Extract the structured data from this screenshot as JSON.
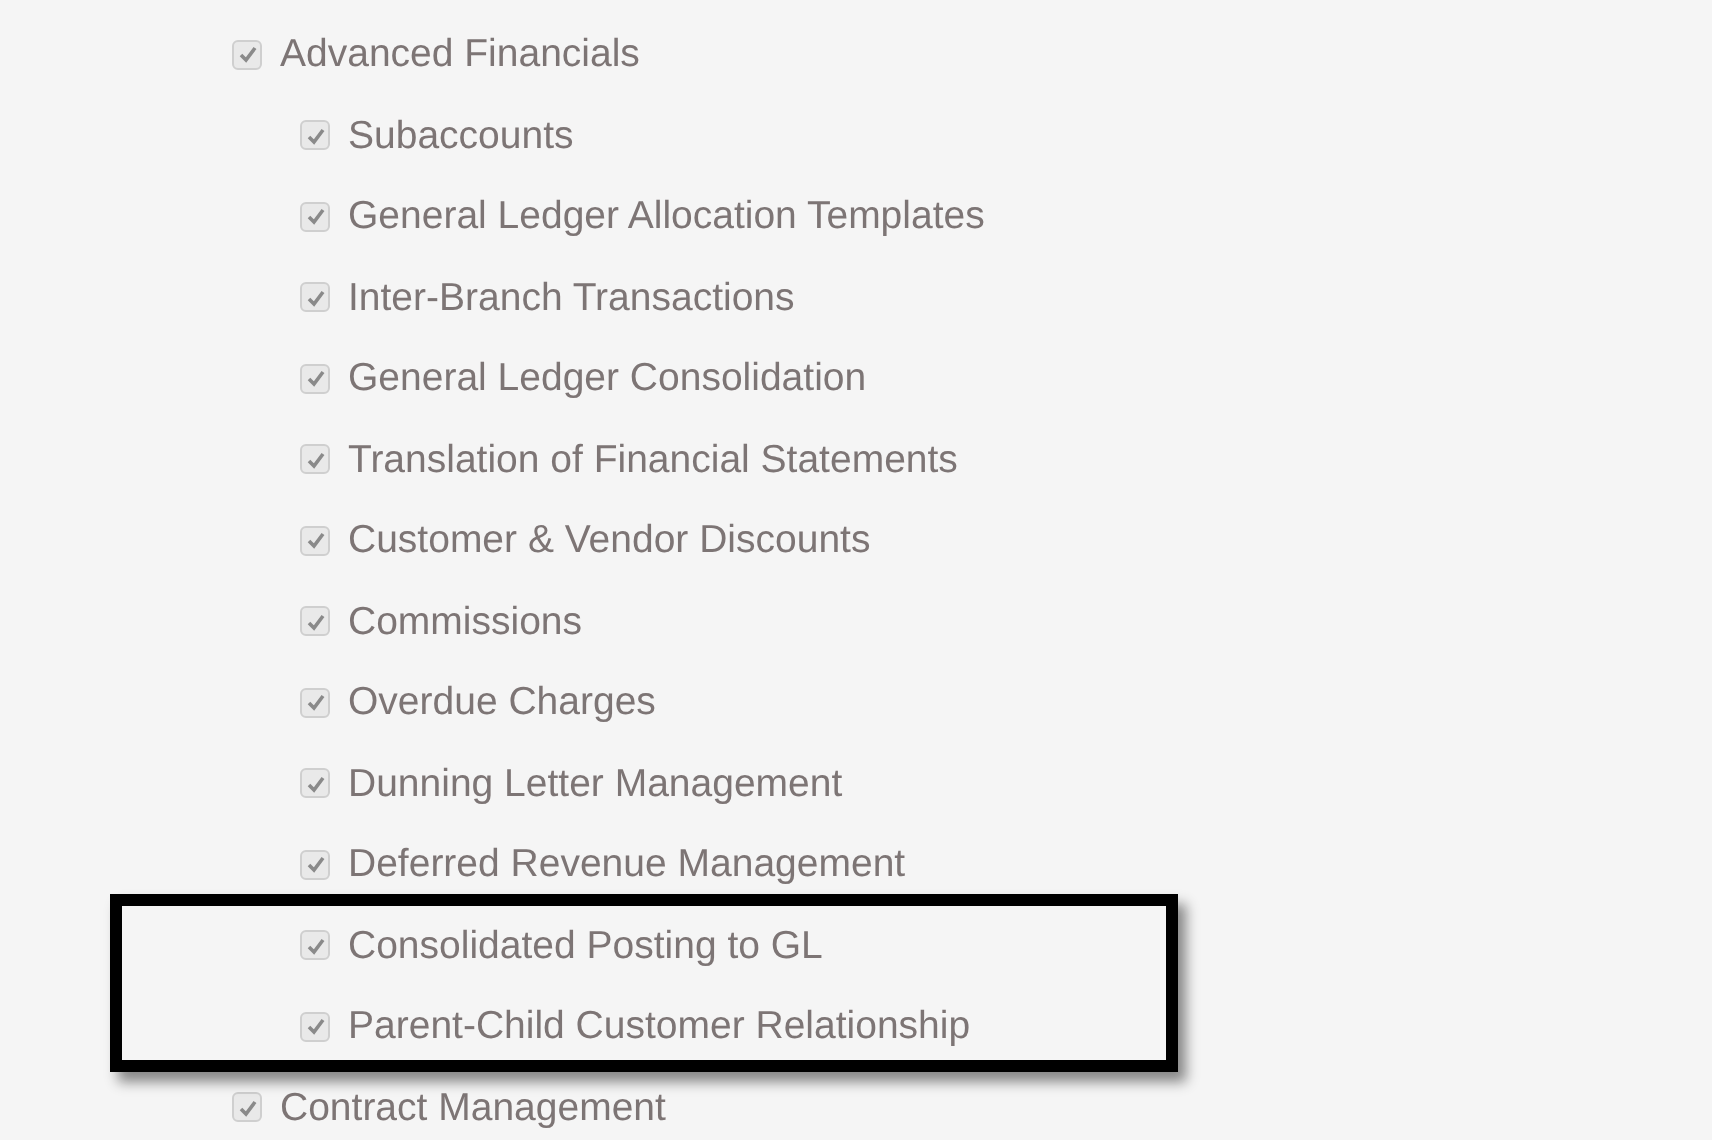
{
  "features": [
    {
      "label": "Advanced Financials",
      "checked": true,
      "children": [
        {
          "label": "Subaccounts",
          "checked": true
        },
        {
          "label": "General Ledger Allocation Templates",
          "checked": true
        },
        {
          "label": "Inter-Branch Transactions",
          "checked": true
        },
        {
          "label": "General Ledger Consolidation",
          "checked": true
        },
        {
          "label": "Translation of Financial Statements",
          "checked": true
        },
        {
          "label": "Customer & Vendor Discounts",
          "checked": true
        },
        {
          "label": "Commissions",
          "checked": true
        },
        {
          "label": "Overdue Charges",
          "checked": true
        },
        {
          "label": "Dunning Letter Management",
          "checked": true
        },
        {
          "label": "Deferred Revenue Management",
          "checked": true
        },
        {
          "label": "Consolidated Posting to GL",
          "checked": true
        },
        {
          "label": "Parent-Child Customer Relationship",
          "checked": true
        }
      ]
    },
    {
      "label": "Contract Management",
      "checked": true
    }
  ]
}
